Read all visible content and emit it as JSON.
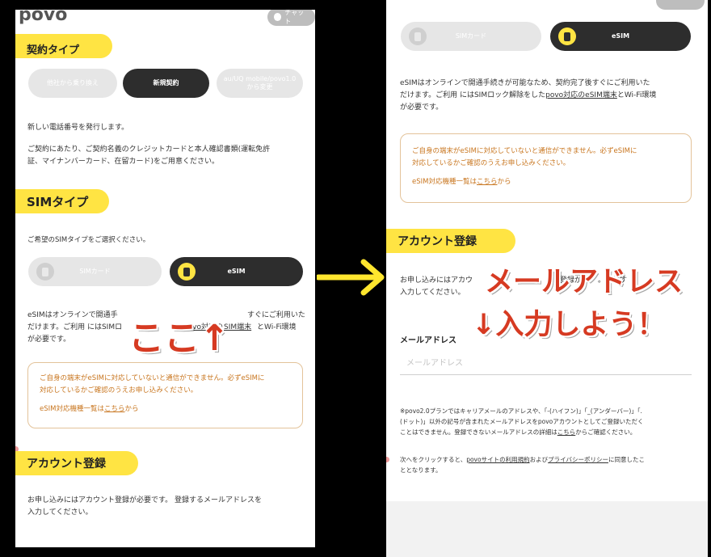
{
  "left": {
    "logo": "povo",
    "chat_label": "チャット",
    "contract_section_title": "契約タイプ",
    "contract_options": [
      "他社から乗り換え",
      "新規契約",
      "au/UQ mobile/povo1.0から変更"
    ],
    "contract_note_1": "新しい電話番号を発行します。",
    "contract_note_2a": "ご契約にあたり、ご契約名義のクレジットカードと本人確認書類(運転免許",
    "contract_note_2b": "証、マイナンバーカード、在留カード)をご用意ください。",
    "sim_section_title": "SIMタイプ",
    "sim_prompt": "ご希望のSIMタイプをご選択ください。",
    "sim_options": [
      "SIMカード",
      "eSIM"
    ],
    "esim_desc_1a": "eSIMはオンラインで開通手",
    "esim_desc_1b": "すぐにご利用いた",
    "esim_desc_2a": "だけます。ご利用 にはSIMロ",
    "esim_desc_2b": "povo対応の",
    "esim_desc_2c": "SIM端末",
    "esim_desc_2d": "とWi-Fi環境",
    "esim_desc_3": "が必要です。",
    "notice_1": "ご自身の端末がeSIMに対応していないと通信ができません。必ずeSIMに",
    "notice_2": "対応しているかご確認のうえお申し込みください。",
    "notice_link_pre": "eSIM対応機種一覧は",
    "notice_link": "こちら",
    "notice_link_post": "から",
    "account_section_title": "アカウント登録",
    "account_desc_1": "お申し込みにはアカウント登録が必要です。 登録するメールアドレスを",
    "account_desc_2": "入力してください。",
    "annotation": "ここ↑"
  },
  "arrow": "→",
  "right": {
    "sim_options": [
      "SIMカード",
      "eSIM"
    ],
    "esim_desc_1": "eSIMはオンラインで開通手続きが可能なため、契約完了後すぐにご利用いた",
    "esim_desc_2a": "だけます。ご利用 にはSIMロック解除をした",
    "esim_desc_2b": "povo対応のeSIM端末",
    "esim_desc_2c": "とWi-Fi環境",
    "esim_desc_3": "が必要です。",
    "notice_1": "ご自身の端末がeSIMに対応していないと通信ができません。必ずeSIMに",
    "notice_2": "対応しているかご確認のうえお申し込みください。",
    "notice_link_pre": "eSIM対応機種一覧は",
    "notice_link": "こちら",
    "notice_link_post": "から",
    "account_section_title": "アカウント登録",
    "account_desc_1": "お申し込みにはアカウ",
    "account_desc_1b": "登録が必",
    "account_desc_1c": "。登録す",
    "account_desc_2": "入力してください。",
    "email_label": "メールアドレス",
    "email_placeholder": "メールアドレス",
    "fine_1": "※povo2.0プランではキャリアメールのアドレスや、「-(ハイフン)」「_(アンダーバー)」「.",
    "fine_2": "(ドット)」以外の記号が含まれたメールアドレスをpovoアカウントとしてご登録いただく",
    "fine_3a": "ことはできません。登録できないメールアドレスの詳細は",
    "fine_3b": "こちら",
    "fine_3c": "からご確認ください。",
    "terms_1a": "次へをクリックすると、",
    "terms_1b": "povoサイトの利用規約",
    "terms_1c": "および",
    "terms_1d": "プライバシーポリシー",
    "terms_1e": "に同意したこ",
    "terms_2": "ととなります。",
    "annotation_1": "メールアドレス",
    "annotation_2": "↓入力しよう！"
  },
  "colors": {
    "accent_yellow": "#ffe443",
    "dark_button": "#2d2d2d",
    "notice_orange": "#c8751e",
    "annotation_red": "#d63a22",
    "arrow_yellow": "#ffe62e"
  }
}
